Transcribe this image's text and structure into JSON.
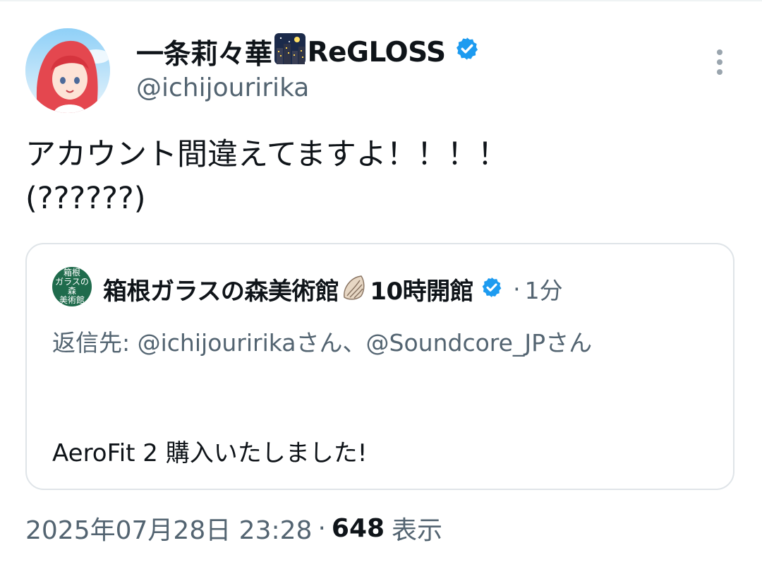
{
  "tweet": {
    "display_name": "一条莉々華",
    "display_name_suffix": "ReGLOSS",
    "handle": "@ichijouririka",
    "text": "アカウント間違えてますよ！！！！\n(??????)",
    "timestamp": "2025年07月28日 23:28",
    "separator": "·",
    "views": "648",
    "views_label": "表示",
    "icons": {
      "name_emoji": "night-city-emoji",
      "verified": "verified-badge-icon",
      "more": "more-vertical-icon"
    }
  },
  "quote": {
    "avatar_text": [
      "箱根",
      "ガラスの森",
      "美術館"
    ],
    "name": "箱根ガラスの森美術館",
    "name_suffix": "10時開館",
    "time_separator": "·",
    "time": "1分",
    "reply_prefix": "返信先:",
    "reply_mention_1": "@ichijouririka",
    "reply_joiner_1": "さん、",
    "reply_mention_2": "@Soundcore_JP",
    "reply_joiner_2": "さん",
    "body": "AeroFit 2 購入いたしました!",
    "icons": {
      "name_emoji": "spiral-shell-emoji",
      "verified": "verified-badge-icon"
    }
  },
  "colors": {
    "text_primary": "#0f1419",
    "text_secondary": "#536471",
    "verified_blue": "#1d9bf0",
    "border": "#dfe4e8"
  }
}
